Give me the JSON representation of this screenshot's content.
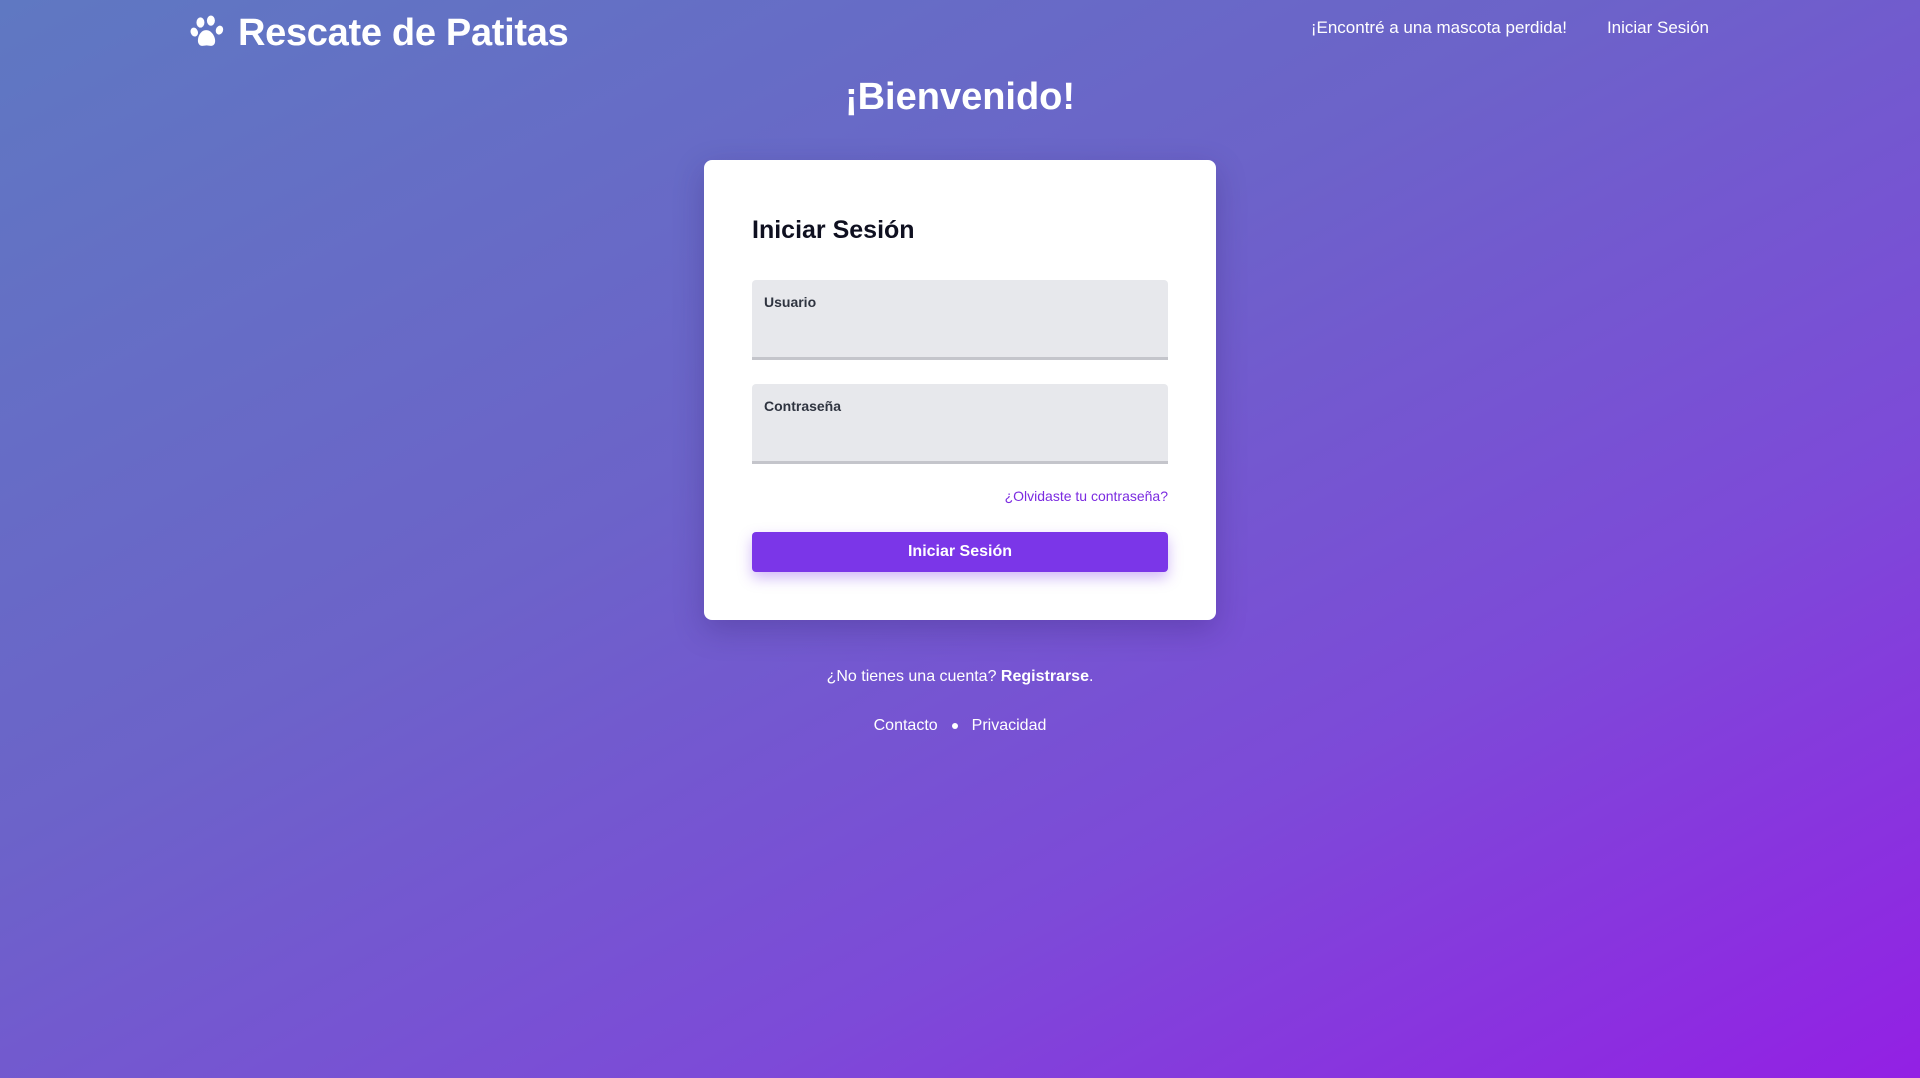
{
  "header": {
    "brand_name": "Rescate de Patitas",
    "brand_icon": "paw-icon",
    "nav": [
      {
        "label": "¡Encontré a una mascota perdida!"
      },
      {
        "label": "Iniciar Sesión"
      }
    ]
  },
  "welcome": "¡Bienvenido!",
  "login_card": {
    "title": "Iniciar Sesión",
    "username_label": "Usuario",
    "username_value": "",
    "password_label": "Contraseña",
    "password_value": "",
    "forgot_link": "¿Olvidaste tu contraseña?",
    "submit_label": "Iniciar Sesión"
  },
  "signup": {
    "prompt": "¿No tienes una cuenta?",
    "link": "Registrarse",
    "suffix": "."
  },
  "footer": {
    "links": [
      {
        "label": "Contacto"
      },
      {
        "label": "Privacidad"
      }
    ]
  },
  "colors": {
    "accent": "#7b36e8",
    "link": "#7b2be0",
    "gradient_start": "#5f78c2",
    "gradient_end": "#9320e4"
  }
}
